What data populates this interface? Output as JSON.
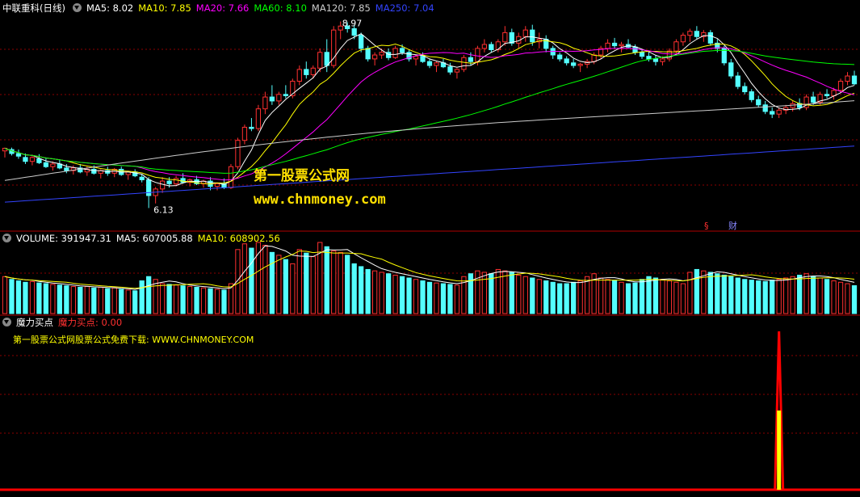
{
  "price_panel": {
    "stock_name": "中联重科(日线)",
    "ma_labels": [
      {
        "text": "MA5: 8.02",
        "color": "#ffffff"
      },
      {
        "text": "MA10: 7.85",
        "color": "#ffff00"
      },
      {
        "text": "MA20: 7.66",
        "color": "#ff00ff"
      },
      {
        "text": "MA60: 8.10",
        "color": "#00ff00"
      },
      {
        "text": "MA120: 7.85",
        "color": "#cccccc"
      },
      {
        "text": "MA250: 7.04",
        "color": "#3344ff"
      }
    ],
    "high_label": "8.97",
    "low_label": "6.13",
    "markers": [
      "§",
      "财"
    ],
    "watermark_title": "第一股票公式网",
    "watermark_url": "www.chnmoney.com"
  },
  "volume_panel": {
    "labels": [
      {
        "text": "VOLUME: 391947.31",
        "color": "#ffffff"
      },
      {
        "text": "MA5: 607005.88",
        "color": "#ffffff"
      },
      {
        "text": "MA10: 608902.56",
        "color": "#ffff00"
      }
    ]
  },
  "indicator_panel": {
    "name": "魔力买点",
    "value_label": "魔力买点: 0.00",
    "note": "第一股票公式网股票公式免费下载: WWW.CHNMONEY.COM"
  },
  "colors": {
    "up": "#ff3030",
    "down": "#54ffff",
    "grid": "#8b0000",
    "ma5": "#ffffff",
    "ma10": "#ffff00",
    "ma20": "#ff00ff",
    "ma60": "#00ff00",
    "ma120": "#cccccc",
    "ma250": "#3344ff",
    "signal": "#ff0000",
    "signal_fill": "#ffff00"
  },
  "chart_data": [
    {
      "type": "candlestick",
      "title": "中联重科(日线)",
      "ylim": [
        6.0,
        9.1
      ],
      "notable_values": {
        "high": 8.97,
        "low": 6.13
      },
      "ohlc": [
        [
          7.0,
          7.05,
          6.9,
          7.04
        ],
        [
          7.02,
          7.05,
          6.93,
          6.96
        ],
        [
          6.96,
          7.02,
          6.88,
          6.92
        ],
        [
          6.9,
          6.96,
          6.8,
          6.84
        ],
        [
          6.84,
          6.92,
          6.78,
          6.9
        ],
        [
          6.88,
          6.95,
          6.8,
          6.82
        ],
        [
          6.82,
          6.9,
          6.74,
          6.76
        ],
        [
          6.76,
          6.84,
          6.7,
          6.8
        ],
        [
          6.8,
          6.86,
          6.72,
          6.74
        ],
        [
          6.74,
          6.8,
          6.66,
          6.7
        ],
        [
          6.7,
          6.78,
          6.64,
          6.74
        ],
        [
          6.74,
          6.8,
          6.66,
          6.68
        ],
        [
          6.68,
          6.76,
          6.62,
          6.72
        ],
        [
          6.72,
          6.78,
          6.64,
          6.66
        ],
        [
          6.66,
          6.72,
          6.58,
          6.7
        ],
        [
          6.7,
          6.76,
          6.62,
          6.66
        ],
        [
          6.66,
          6.74,
          6.6,
          6.72
        ],
        [
          6.72,
          6.76,
          6.62,
          6.64
        ],
        [
          6.64,
          6.7,
          6.56,
          6.68
        ],
        [
          6.68,
          6.72,
          6.6,
          6.62
        ],
        [
          6.6,
          6.64,
          6.52,
          6.56
        ],
        [
          6.56,
          6.6,
          6.13,
          6.32
        ],
        [
          6.32,
          6.45,
          6.2,
          6.42
        ],
        [
          6.42,
          6.6,
          6.36,
          6.54
        ],
        [
          6.54,
          6.6,
          6.44,
          6.5
        ],
        [
          6.5,
          6.62,
          6.46,
          6.58
        ],
        [
          6.58,
          6.66,
          6.5,
          6.52
        ],
        [
          6.52,
          6.58,
          6.46,
          6.56
        ],
        [
          6.56,
          6.62,
          6.48,
          6.5
        ],
        [
          6.5,
          6.56,
          6.44,
          6.54
        ],
        [
          6.54,
          6.6,
          6.4,
          6.46
        ],
        [
          6.46,
          6.52,
          6.4,
          6.5
        ],
        [
          6.5,
          6.58,
          6.42,
          6.44
        ],
        [
          6.44,
          6.8,
          6.42,
          6.76
        ],
        [
          6.76,
          7.2,
          6.72,
          7.16
        ],
        [
          7.16,
          7.4,
          7.1,
          7.36
        ],
        [
          7.36,
          7.5,
          7.3,
          7.34
        ],
        [
          7.34,
          7.7,
          7.3,
          7.64
        ],
        [
          7.64,
          7.9,
          7.56,
          7.82
        ],
        [
          7.82,
          8.0,
          7.7,
          7.76
        ],
        [
          7.76,
          7.9,
          7.7,
          7.86
        ],
        [
          7.86,
          8.0,
          7.8,
          7.84
        ],
        [
          7.84,
          8.1,
          7.8,
          8.06
        ],
        [
          8.06,
          8.3,
          8.0,
          8.24
        ],
        [
          8.24,
          8.36,
          8.1,
          8.16
        ],
        [
          8.16,
          8.3,
          8.1,
          8.26
        ],
        [
          8.26,
          8.56,
          8.2,
          8.5
        ],
        [
          8.5,
          8.7,
          8.2,
          8.3
        ],
        [
          8.3,
          8.9,
          8.26,
          8.84
        ],
        [
          8.84,
          8.97,
          8.7,
          8.9
        ],
        [
          8.9,
          8.96,
          8.8,
          8.86
        ],
        [
          8.86,
          8.92,
          8.7,
          8.76
        ],
        [
          8.76,
          8.8,
          8.5,
          8.56
        ],
        [
          8.56,
          8.6,
          8.36,
          8.4
        ],
        [
          8.4,
          8.5,
          8.3,
          8.46
        ],
        [
          8.46,
          8.56,
          8.4,
          8.5
        ],
        [
          8.5,
          8.56,
          8.38,
          8.42
        ],
        [
          8.42,
          8.6,
          8.4,
          8.56
        ],
        [
          8.56,
          8.62,
          8.46,
          8.5
        ],
        [
          8.5,
          8.54,
          8.36,
          8.4
        ],
        [
          8.4,
          8.46,
          8.3,
          8.44
        ],
        [
          8.44,
          8.5,
          8.34,
          8.36
        ],
        [
          8.36,
          8.4,
          8.26,
          8.3
        ],
        [
          8.3,
          8.36,
          8.2,
          8.34
        ],
        [
          8.34,
          8.4,
          8.26,
          8.28
        ],
        [
          8.28,
          8.34,
          8.16,
          8.2
        ],
        [
          8.2,
          8.26,
          8.1,
          8.24
        ],
        [
          8.24,
          8.46,
          8.2,
          8.42
        ],
        [
          8.42,
          8.5,
          8.3,
          8.36
        ],
        [
          8.36,
          8.6,
          8.3,
          8.56
        ],
        [
          8.56,
          8.7,
          8.5,
          8.62
        ],
        [
          8.62,
          8.66,
          8.5,
          8.54
        ],
        [
          8.54,
          8.7,
          8.5,
          8.66
        ],
        [
          8.66,
          8.9,
          8.6,
          8.8
        ],
        [
          8.8,
          8.86,
          8.6,
          8.64
        ],
        [
          8.64,
          8.8,
          8.56,
          8.74
        ],
        [
          8.74,
          8.9,
          8.66,
          8.84
        ],
        [
          8.84,
          8.92,
          8.6,
          8.66
        ],
        [
          8.66,
          8.8,
          8.56,
          8.7
        ],
        [
          8.7,
          8.76,
          8.5,
          8.56
        ],
        [
          8.56,
          8.6,
          8.4,
          8.46
        ],
        [
          8.46,
          8.5,
          8.36,
          8.4
        ],
        [
          8.4,
          8.44,
          8.3,
          8.34
        ],
        [
          8.34,
          8.4,
          8.26,
          8.3
        ],
        [
          8.3,
          8.34,
          8.2,
          8.32
        ],
        [
          8.32,
          8.4,
          8.26,
          8.36
        ],
        [
          8.36,
          8.5,
          8.32,
          8.46
        ],
        [
          8.46,
          8.6,
          8.4,
          8.56
        ],
        [
          8.56,
          8.7,
          8.5,
          8.64
        ],
        [
          8.64,
          8.72,
          8.56,
          8.6
        ],
        [
          8.6,
          8.66,
          8.5,
          8.62
        ],
        [
          8.62,
          8.7,
          8.56,
          8.58
        ],
        [
          8.58,
          8.62,
          8.46,
          8.5
        ],
        [
          8.5,
          8.54,
          8.4,
          8.44
        ],
        [
          8.44,
          8.5,
          8.36,
          8.4
        ],
        [
          8.4,
          8.46,
          8.3,
          8.36
        ],
        [
          8.36,
          8.44,
          8.3,
          8.4
        ],
        [
          8.4,
          8.56,
          8.36,
          8.52
        ],
        [
          8.52,
          8.7,
          8.46,
          8.66
        ],
        [
          8.66,
          8.8,
          8.6,
          8.76
        ],
        [
          8.76,
          8.86,
          8.66,
          8.82
        ],
        [
          8.82,
          8.9,
          8.7,
          8.74
        ],
        [
          8.74,
          8.84,
          8.66,
          8.8
        ],
        [
          8.8,
          8.84,
          8.6,
          8.64
        ],
        [
          8.64,
          8.7,
          8.5,
          8.56
        ],
        [
          8.56,
          8.6,
          8.3,
          8.34
        ],
        [
          8.34,
          8.4,
          8.1,
          8.14
        ],
        [
          8.14,
          8.2,
          7.94,
          7.98
        ],
        [
          7.98,
          8.04,
          7.86,
          7.9
        ],
        [
          7.9,
          7.94,
          7.74,
          7.78
        ],
        [
          7.78,
          7.84,
          7.66,
          7.7
        ],
        [
          7.7,
          7.76,
          7.56,
          7.6
        ],
        [
          7.6,
          7.66,
          7.5,
          7.56
        ],
        [
          7.56,
          7.66,
          7.5,
          7.62
        ],
        [
          7.62,
          7.7,
          7.56,
          7.66
        ],
        [
          7.66,
          7.76,
          7.6,
          7.72
        ],
        [
          7.72,
          7.8,
          7.62,
          7.66
        ],
        [
          7.66,
          7.86,
          7.62,
          7.82
        ],
        [
          7.82,
          7.9,
          7.7,
          7.74
        ],
        [
          7.74,
          7.9,
          7.7,
          7.86
        ],
        [
          7.86,
          7.94,
          7.8,
          7.84
        ],
        [
          7.84,
          7.96,
          7.78,
          7.92
        ],
        [
          7.92,
          8.1,
          7.88,
          8.06
        ],
        [
          8.06,
          8.2,
          8.0,
          8.14
        ],
        [
          8.14,
          8.22,
          8.0,
          8.02
        ]
      ]
    },
    {
      "type": "bar",
      "title": "VOLUME",
      "note": "volume bars, red = up day, cyan = down day",
      "ylim": [
        0,
        1000000
      ],
      "values": [
        520000,
        480000,
        460000,
        440000,
        450000,
        430000,
        420000,
        410000,
        400000,
        390000,
        380000,
        370000,
        380000,
        360000,
        370000,
        350000,
        360000,
        340000,
        330000,
        320000,
        460000,
        520000,
        480000,
        420000,
        410000,
        400000,
        390000,
        380000,
        370000,
        360000,
        350000,
        340000,
        330000,
        420000,
        900000,
        980000,
        920000,
        1000000,
        960000,
        860000,
        820000,
        760000,
        700000,
        900000,
        850000,
        800000,
        1000000,
        940000,
        880000,
        860000,
        820000,
        700000,
        660000,
        620000,
        600000,
        580000,
        560000,
        540000,
        520000,
        500000,
        480000,
        460000,
        440000,
        430000,
        420000,
        410000,
        400000,
        520000,
        560000,
        600000,
        580000,
        560000,
        620000,
        600000,
        580000,
        540000,
        520000,
        500000,
        480000,
        460000,
        440000,
        420000,
        420000,
        440000,
        460000,
        520000,
        560000,
        500000,
        480000,
        460000,
        440000,
        420000,
        430000,
        480000,
        520000,
        500000,
        480000,
        460000,
        440000,
        420000,
        580000,
        620000,
        600000,
        580000,
        560000,
        540000,
        520000,
        500000,
        480000,
        470000,
        460000,
        450000,
        470000,
        480000,
        500000,
        520000,
        540000,
        560000,
        520000,
        500000,
        480000,
        460000,
        440000,
        420000,
        391947
      ]
    },
    {
      "type": "line",
      "title": "魔力买点",
      "series": [
        {
          "name": "魔力买点",
          "spike_index": 113,
          "spike_value": 1.0,
          "current": 0.0
        }
      ],
      "ylim": [
        0,
        1.0
      ]
    }
  ]
}
